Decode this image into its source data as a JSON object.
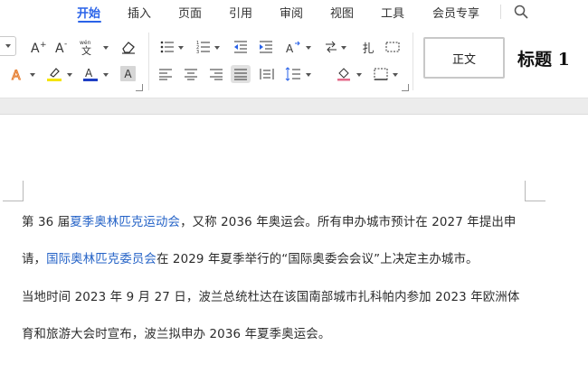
{
  "menu": {
    "tabs": [
      {
        "label": "开始",
        "active": true
      },
      {
        "label": "插入"
      },
      {
        "label": "页面"
      },
      {
        "label": "引用"
      },
      {
        "label": "审阅"
      },
      {
        "label": "视图"
      },
      {
        "label": "工具"
      },
      {
        "label": "会员专享"
      }
    ]
  },
  "ribbon": {
    "phonetic_label": "wén",
    "styles": {
      "normal": "正文",
      "heading1": "标题 1"
    },
    "colors": {
      "highlight": "#f5e400",
      "font_color": "#1f3fc4",
      "accent": "#2a63e8"
    }
  },
  "document": {
    "para1": {
      "l1_a": "第 36 届",
      "l1_link": "夏季奥林匹克运动会",
      "l1_b": "，又称 2036 年奥运会。所有申办城市预计在 2027 年提出申",
      "l2_a": "请，",
      "l2_link": "国际奥林匹克委员会",
      "l2_b": "在 2029 年夏季举行的“国际奥委会会议”上决定主办城市。"
    },
    "para2": {
      "l1": "当地时间 2023 年 9 月 27 日，波兰总统杜达在该国南部城市扎科帕内参加 2023 年欧洲体",
      "l2": "育和旅游大会时宣布，波兰拟申办 2036 年夏季奥运会。"
    }
  }
}
